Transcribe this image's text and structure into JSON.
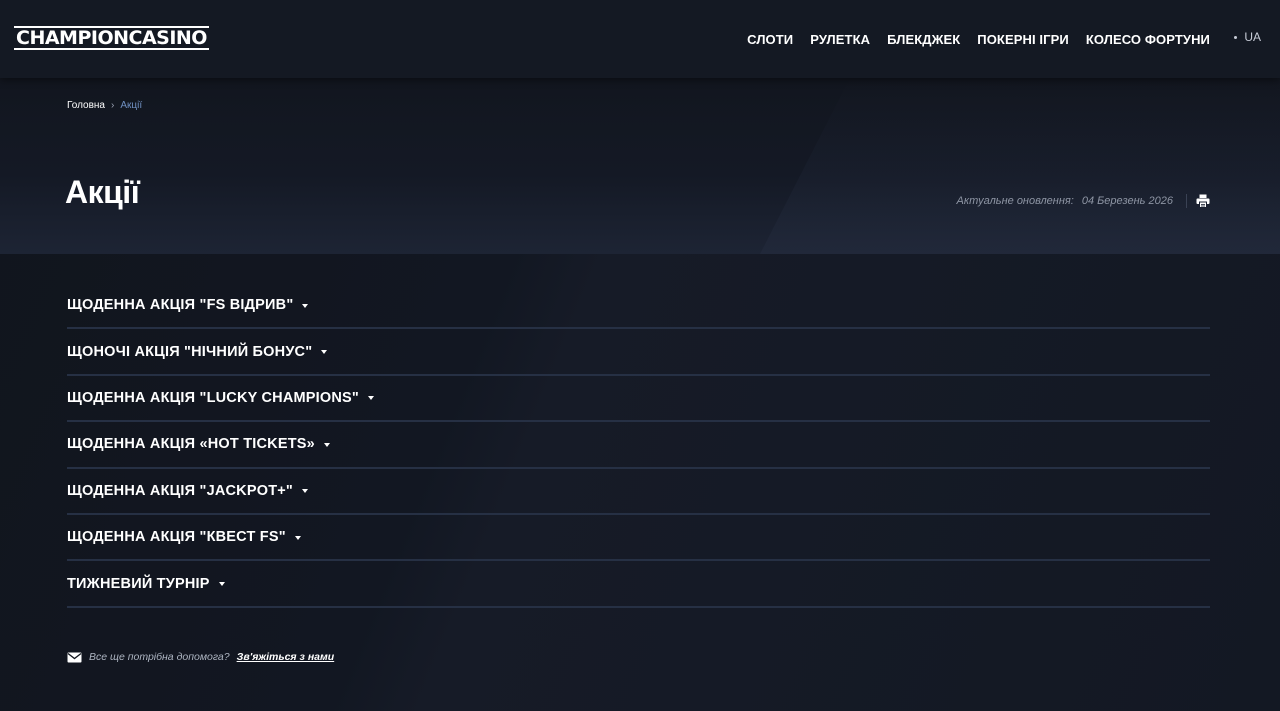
{
  "header": {
    "logo_text": "ChampionCasino",
    "nav": [
      {
        "label": "СЛОТИ"
      },
      {
        "label": "РУЛЕТКА"
      },
      {
        "label": "БЛЕКДЖЕК"
      },
      {
        "label": "ПОКЕРНІ ІГРИ"
      },
      {
        "label": "КОЛЕСО ФОРТУНИ"
      }
    ],
    "lang": "UA"
  },
  "breadcrumb": {
    "home": "Головна",
    "separator": "›",
    "current": "Акції"
  },
  "page": {
    "title": "Акції",
    "updated_label": "Актуальне оновлення:",
    "updated_date": "04 Березень 2026",
    "print_icon": "printer-icon"
  },
  "accordion": [
    {
      "label": "ЩОДЕННА АКЦІЯ \"FS ВІДРИВ\""
    },
    {
      "label": "ЩОНОЧІ АКЦІЯ \"НІЧНИЙ БОНУС\""
    },
    {
      "label": "ЩОДЕННА АКЦІЯ \"LUCKY CHAMPIONS\""
    },
    {
      "label": "ЩОДЕННА АКЦІЯ «HOT TICKETS»"
    },
    {
      "label": "ЩОДЕННА АКЦІЯ  \"JACKPOT+\""
    },
    {
      "label": "ЩОДЕННА АКЦІЯ \"КВЕСТ FS\""
    },
    {
      "label": "ТИЖНЕВИЙ ТУРНІР"
    }
  ],
  "help": {
    "text": "Все ще потрібна допомога?",
    "link": "Зв'яжіться з нами",
    "icon": "mail-icon"
  },
  "colors": {
    "background": "#12161f",
    "header": "#141923",
    "divider": "#263044",
    "breadcrumb_current": "#6f8fc0"
  }
}
